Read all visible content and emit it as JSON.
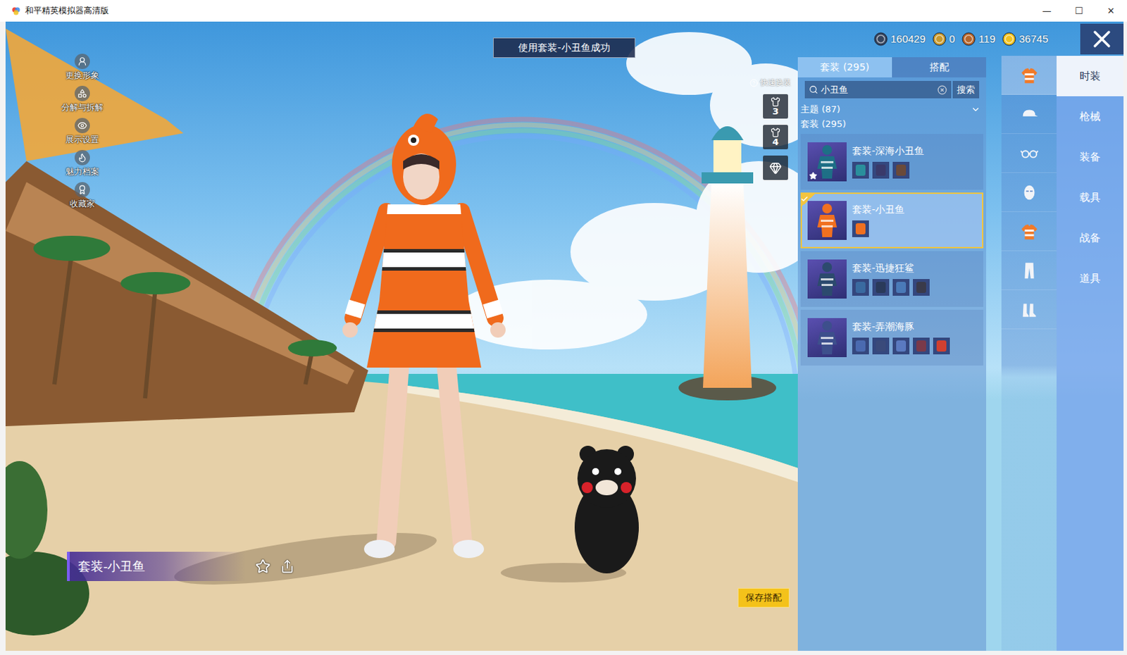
{
  "window": {
    "title": "和平精英模拟器高清版",
    "controls": [
      {
        "label": "—"
      },
      {
        "label": "☐"
      },
      {
        "label": "✕"
      }
    ]
  },
  "toast": "使用套装-小丑鱼成功",
  "side_menu": [
    {
      "label": "更换形象"
    },
    {
      "label": "分解与拆解"
    },
    {
      "label": "展示设置"
    },
    {
      "label": "魅力档案"
    },
    {
      "label": "收藏家"
    }
  ],
  "currencies": [
    {
      "amount": "160429",
      "color": "#34445e"
    },
    {
      "amount": "0",
      "color": "#c99a2c"
    },
    {
      "amount": "119",
      "color": "#b5652b"
    },
    {
      "amount": "36745",
      "color": "#f2c21e"
    }
  ],
  "quick_switch": {
    "label": "快速换装",
    "slots": [
      {
        "label": "3"
      },
      {
        "label": "4"
      }
    ]
  },
  "panel": {
    "tabs": [
      {
        "label": "套装 (295)",
        "selected": true
      },
      {
        "label": "搭配",
        "selected": false
      }
    ],
    "search": {
      "value": "小丑鱼",
      "button": "搜索"
    },
    "theme": {
      "label": "主题 (87)",
      "expanded": false
    },
    "section": "套装 (295)",
    "items": [
      {
        "name": "套装-深海小丑鱼",
        "selected": false,
        "favorite": true,
        "color": "#1e6f86",
        "parts": [
          "#2a8f9c",
          "#3a3a6a",
          "#6a4a3a"
        ]
      },
      {
        "name": "套装-小丑鱼",
        "selected": true,
        "favorite": false,
        "color": "#f07020",
        "parts": [
          "#f07020"
        ]
      },
      {
        "name": "套装-迅捷狂鲨",
        "selected": false,
        "favorite": false,
        "color": "#2c4a6e",
        "parts": [
          "#3a6aa0",
          "#2a3a5a",
          "#4a7ab8",
          "#3a3a4a"
        ]
      },
      {
        "name": "套装-弄潮海豚",
        "selected": false,
        "favorite": false,
        "color": "#3d4f8c",
        "parts": [
          "#4a6ab0",
          "#3a4a7a",
          "#5a7ac0",
          "#7a3a4a",
          "#d04030"
        ]
      }
    ]
  },
  "categories": [
    {
      "kind": "outfit",
      "selected": true
    },
    {
      "kind": "hat",
      "selected": false
    },
    {
      "kind": "glasses",
      "selected": false
    },
    {
      "kind": "mask",
      "selected": false
    },
    {
      "kind": "outfit",
      "selected": false
    },
    {
      "kind": "pants",
      "selected": false
    },
    {
      "kind": "shoes",
      "selected": false
    }
  ],
  "nav_tabs": [
    {
      "label": "时装",
      "selected": true
    },
    {
      "label": "枪械",
      "selected": false
    },
    {
      "label": "装备",
      "selected": false
    },
    {
      "label": "载具",
      "selected": false
    },
    {
      "label": "战备",
      "selected": false
    },
    {
      "label": "道具",
      "selected": false
    }
  ],
  "name_plate": {
    "label": "套装-小丑鱼",
    "favorite": false
  },
  "save_button": "保存搭配"
}
